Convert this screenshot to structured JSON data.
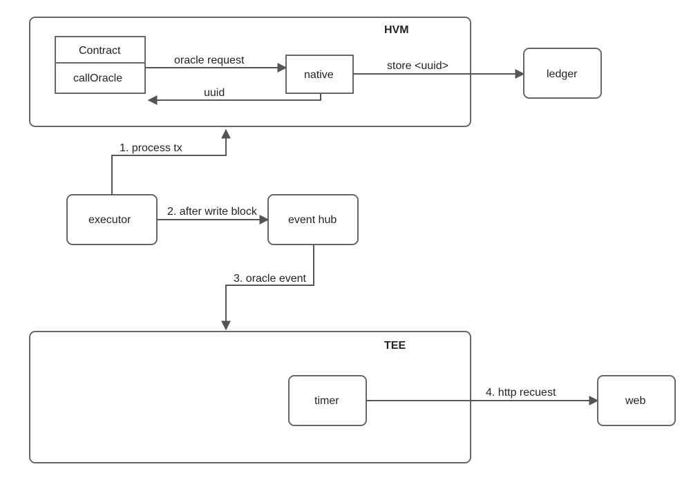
{
  "hvm": {
    "title": "HVM",
    "contract": {
      "label": "Contract",
      "method": "callOracle"
    },
    "native": "native",
    "arrow_request": "oracle request",
    "arrow_uuid": "uuid",
    "arrow_store": "store <uuid>"
  },
  "ledger": "ledger",
  "executor": "executor",
  "eventhub": "event hub",
  "step1": "1. process tx",
  "step2": "2. after write block",
  "step3": "3. oracle event",
  "tee": {
    "title": "TEE",
    "timer": "timer",
    "step4": "4. http recuest"
  },
  "web": "web"
}
